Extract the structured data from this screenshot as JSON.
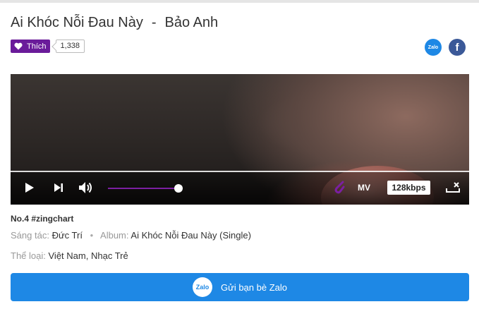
{
  "song": {
    "title": "Ai Khóc Nỗi Đau Này",
    "separator": "-",
    "artist": "Bảo Anh"
  },
  "like": {
    "label": "Thích",
    "count": "1,338",
    "color": "#6a1b9a"
  },
  "share_icons": {
    "zalo_text": "Zalo",
    "facebook_text": "f"
  },
  "player": {
    "volume": 1.0,
    "mv_label": "MV",
    "quality": "128kbps",
    "accent": "#7b1fa2"
  },
  "info": {
    "rank": "No.4 #zingchart",
    "composer_label": "Sáng tác:",
    "composer": "Đức Trí",
    "album_label": "Album:",
    "album": "Ai Khóc Nỗi Đau Này (Single)",
    "genre_label": "Thể loại:",
    "genre_1": "Việt Nam",
    "genre_sep": ",",
    "genre_2": "Nhạc Trẻ"
  },
  "zalo_button": {
    "icon_text": "Zalo",
    "label": "Gửi bạn bè Zalo",
    "color": "#1e88e5"
  }
}
